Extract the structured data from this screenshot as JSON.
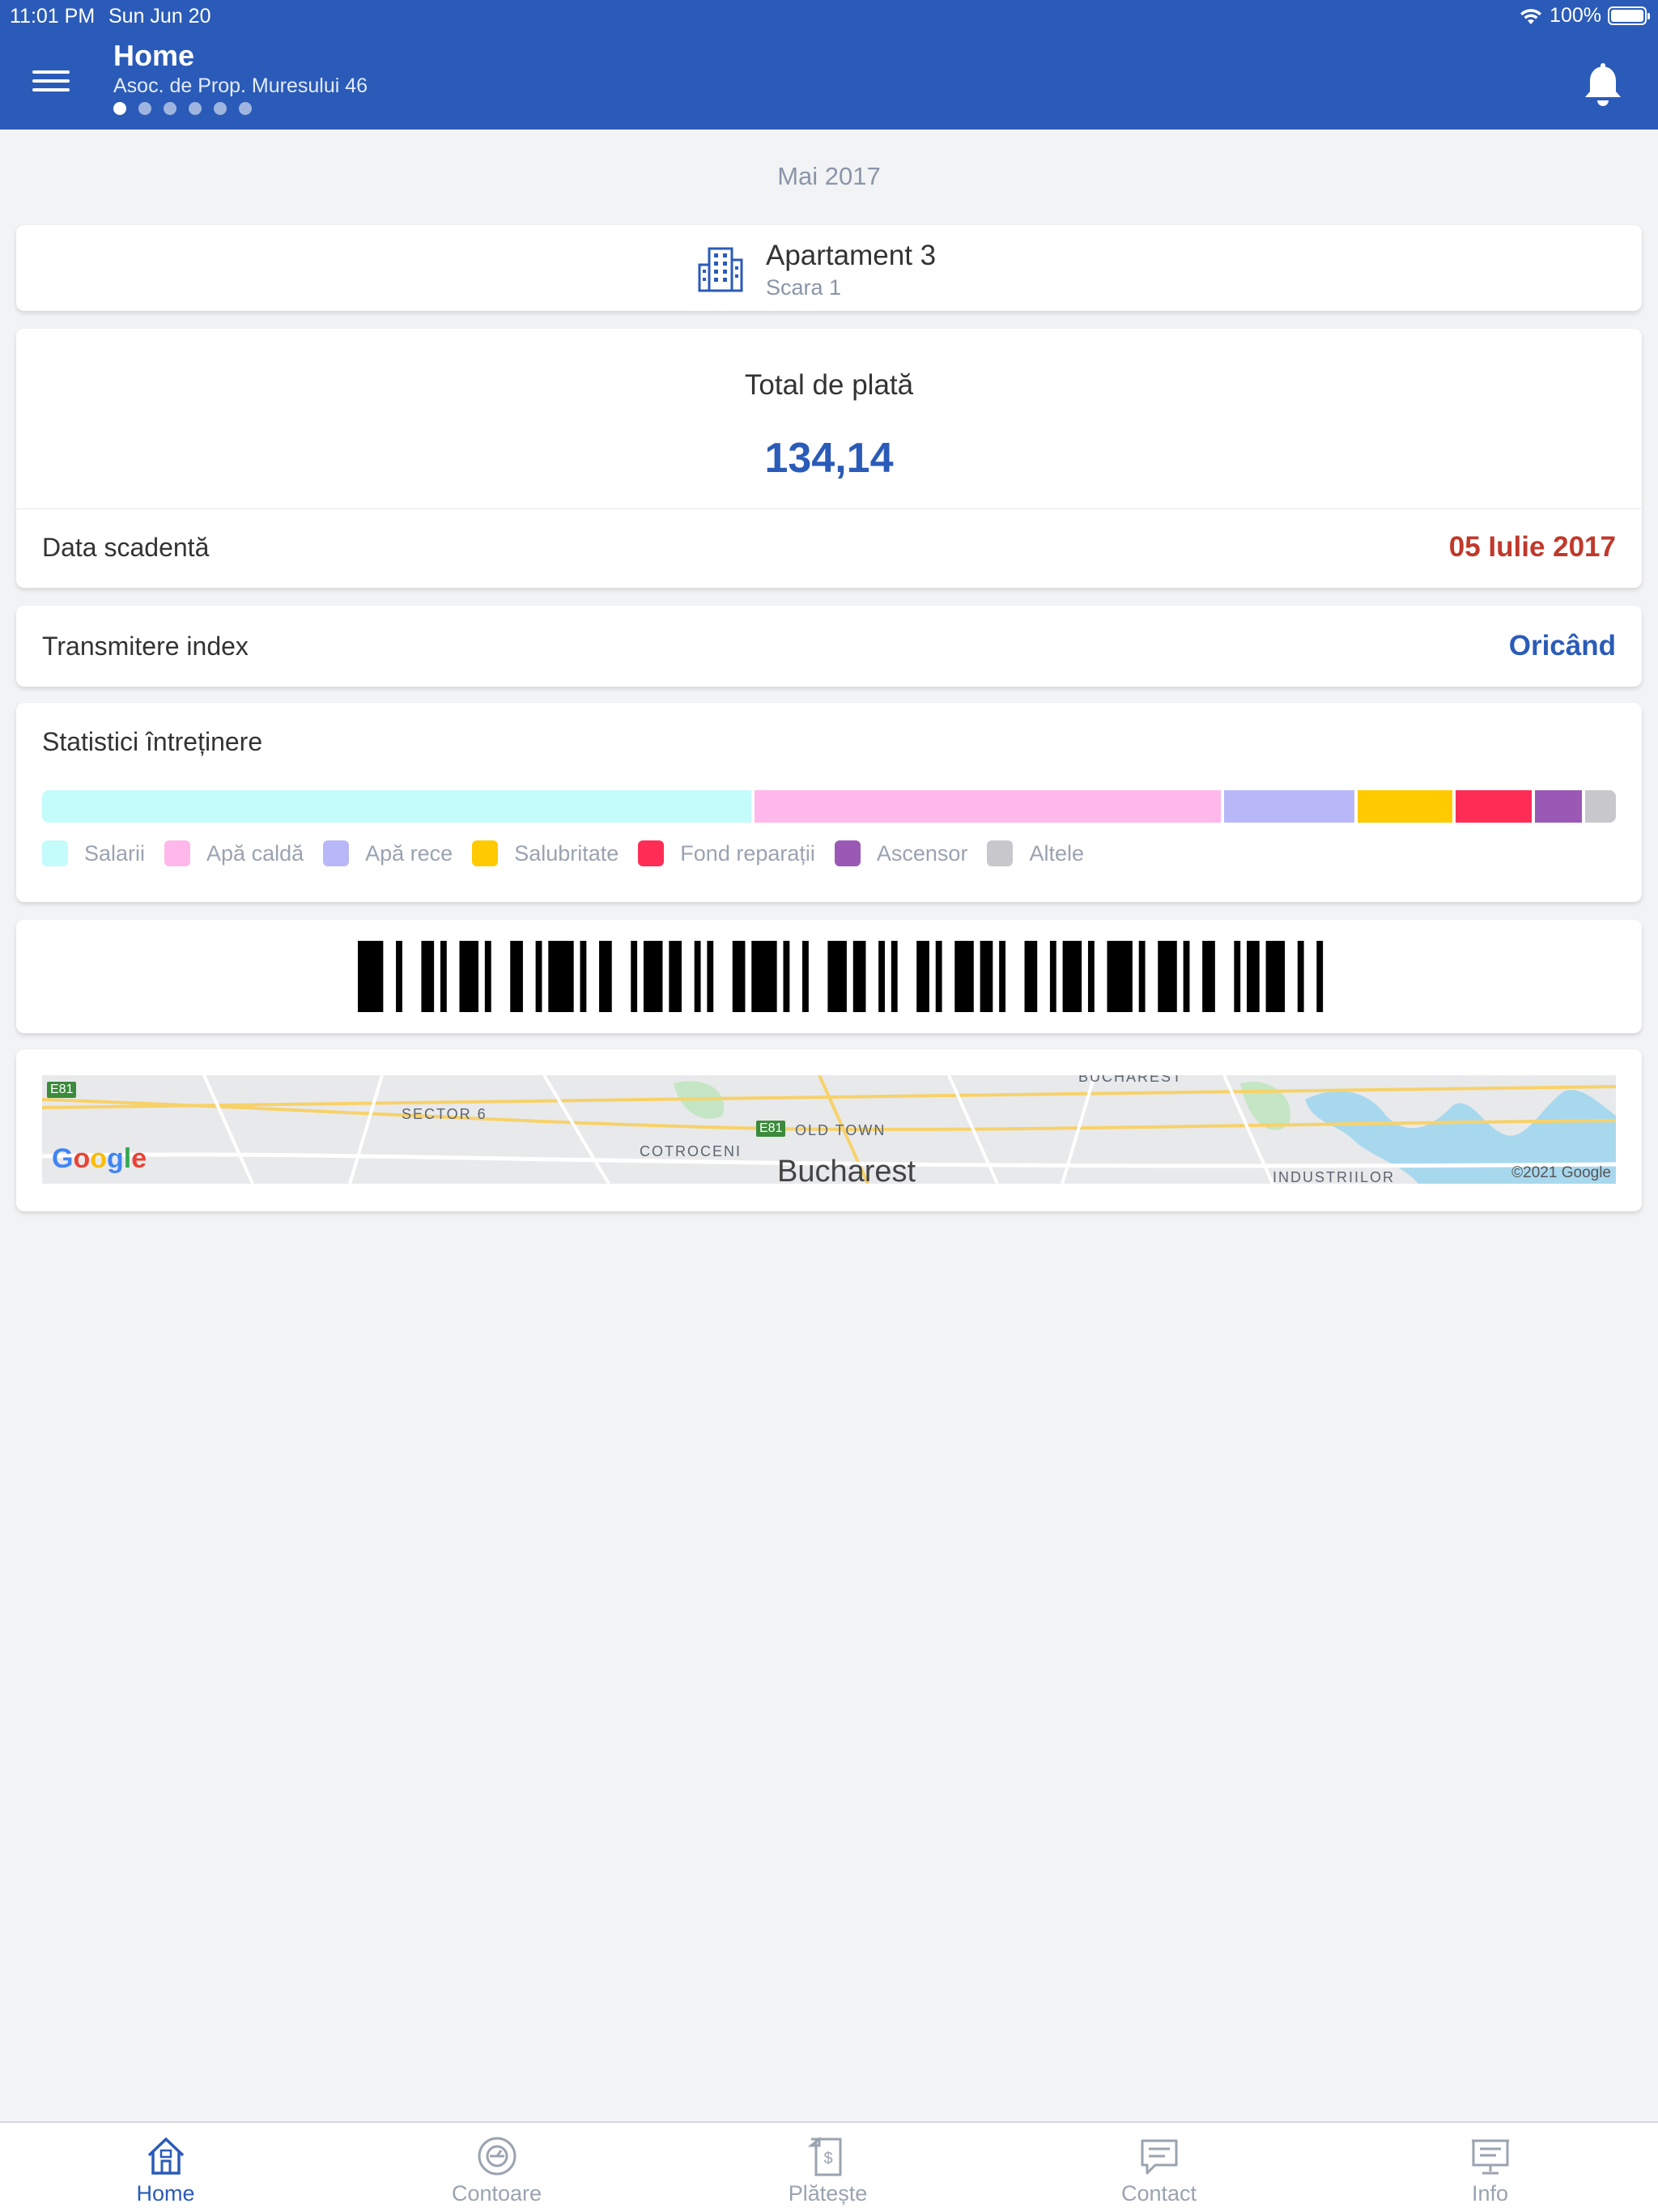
{
  "status": {
    "time": "11:01 PM",
    "date": "Sun Jun 20",
    "battery": "100%",
    "battery_level": 1.0
  },
  "header": {
    "title": "Home",
    "subtitle": "Asoc. de Prop. Muresului 46",
    "page_dots": 6,
    "active_dot": 0
  },
  "period": "Mai 2017",
  "apartment": {
    "name": "Apartament 3",
    "scara": "Scara 1"
  },
  "payment": {
    "total_label": "Total de plată",
    "total_amount": "134,14",
    "due_label": "Data scadentă",
    "due_date": "05 Iulie 2017"
  },
  "index": {
    "label": "Transmitere index",
    "value": "Oricând"
  },
  "stats": {
    "title": "Statistici întreținere",
    "categories": [
      {
        "name": "Salarii",
        "share": 0.456,
        "color": "#c4fbfb"
      },
      {
        "name": "Apă caldă",
        "share": 0.3,
        "color": "#ffb8e9"
      },
      {
        "name": "Apă rece",
        "share": 0.084,
        "color": "#b8b8f8"
      },
      {
        "name": "Salubritate",
        "share": 0.061,
        "color": "#ffca00"
      },
      {
        "name": "Fond reparații",
        "share": 0.049,
        "color": "#ff2d55"
      },
      {
        "name": "Ascensor",
        "share": 0.03,
        "color": "#9b59b6"
      },
      {
        "name": "Altele",
        "share": 0.02,
        "color": "#c8c8cc"
      }
    ]
  },
  "map": {
    "city": "Bucharest",
    "labels": [
      "SECTOR 6",
      "OLD TOWN",
      "COTROCENI",
      "INDUSTRIILOR",
      "BUCHAREST"
    ],
    "shields": [
      "E81",
      "E81"
    ],
    "google": "Google",
    "copyright": "©2021 Google"
  },
  "tabs": [
    {
      "label": "Home",
      "icon": "home-icon"
    },
    {
      "label": "Contoare",
      "icon": "meter-icon"
    },
    {
      "label": "Plătește",
      "icon": "pay-icon"
    },
    {
      "label": "Contact",
      "icon": "chat-icon"
    },
    {
      "label": "Info",
      "icon": "info-board-icon"
    }
  ],
  "active_tab": 0
}
